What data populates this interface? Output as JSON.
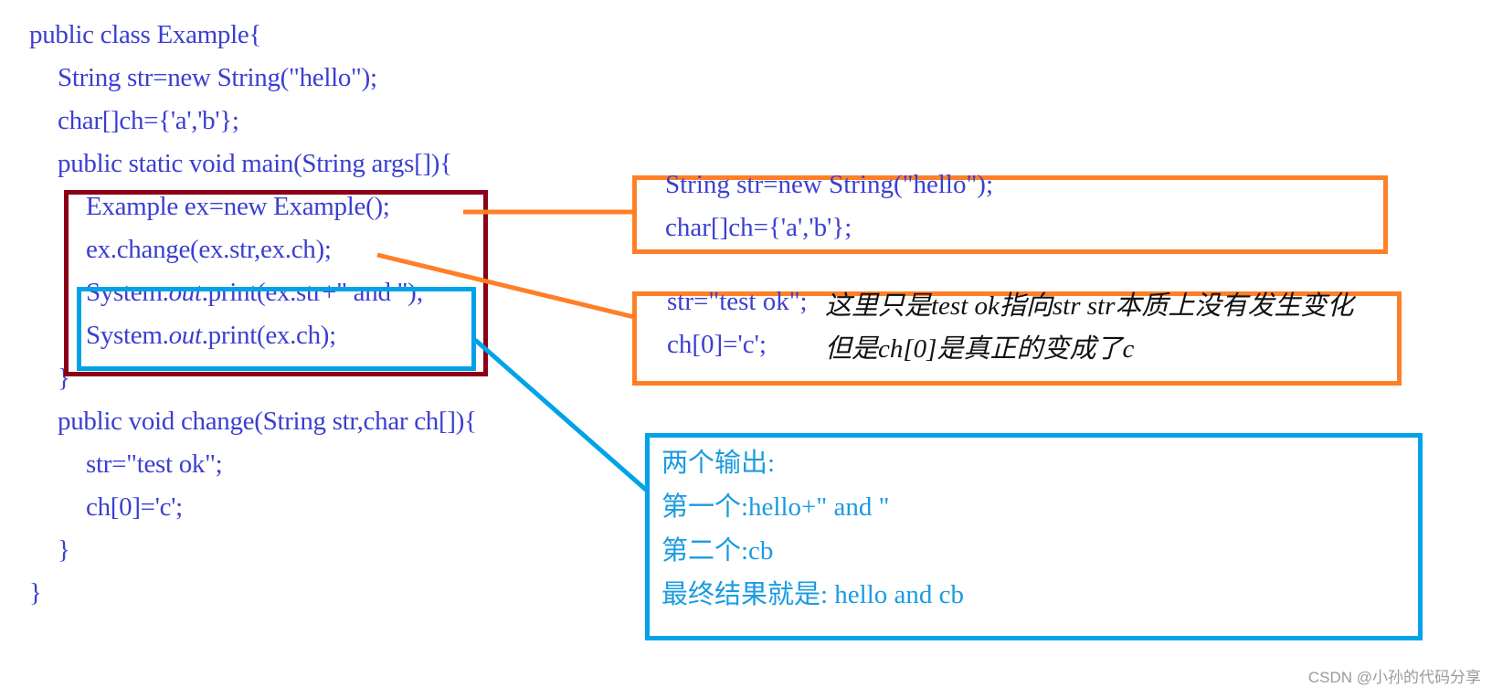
{
  "code": {
    "lines": [
      {
        "text": "public class Example{"
      },
      {
        "text": "String str=new String(\"hello\");"
      },
      {
        "text": "char[]ch={'a','b'};"
      },
      {
        "text": "public static void main(String args[]){"
      },
      {
        "text": "Example ex=new Example();"
      },
      {
        "text": "ex.change(ex.str,ex.ch);"
      },
      {
        "prefix": "System.",
        "italic": "out",
        "suffix": ".print(ex.str+\" and \");"
      },
      {
        "prefix": "System.",
        "italic": "out",
        "suffix": ".print(ex.ch);"
      },
      {
        "text": "}"
      },
      {
        "text": "public void change(String str,char ch[]){"
      },
      {
        "text": "str=\"test ok\";"
      },
      {
        "text": "ch[0]='c';"
      },
      {
        "text": "}"
      },
      {
        "text": "}"
      }
    ]
  },
  "notes": {
    "fields_box": {
      "lines": [
        "String str=new String(\"hello\");",
        "char[]ch={'a','b'};"
      ]
    },
    "change_box": {
      "code_lines": [
        "str=\"test ok\";",
        "ch[0]='c';"
      ],
      "comments": [
        "这里只是test ok指向str str本质上没有发生变化",
        "但是ch[0]是真正的变成了c"
      ]
    },
    "output_box": {
      "lines": [
        "两个输出:",
        "第一个:hello+\" and \"",
        "第二个:cb",
        "最终结果就是: hello and cb"
      ]
    }
  },
  "colors": {
    "code_text": "#3b3fd0",
    "main_body_box": "#8b0016",
    "print_box": "#00a2e8",
    "annotation_orange": "#ff7f27",
    "output_text": "#1b9be0"
  },
  "watermark": "CSDN @小孙的代码分享"
}
